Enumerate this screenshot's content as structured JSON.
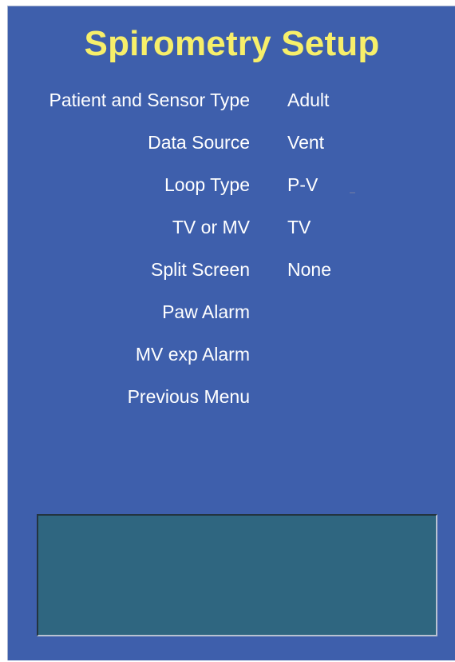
{
  "title": "Spirometry Setup",
  "menu": [
    {
      "label": "Patient and Sensor Type",
      "value": "Adult"
    },
    {
      "label": "Data Source",
      "value": "Vent"
    },
    {
      "label": "Loop Type",
      "value": "P-V"
    },
    {
      "label": "TV or MV",
      "value": "TV"
    },
    {
      "label": "Split Screen",
      "value": "None"
    },
    {
      "label": "Paw Alarm",
      "value": ""
    },
    {
      "label": "MV exp Alarm",
      "value": ""
    },
    {
      "label": "Previous Menu",
      "value": ""
    }
  ],
  "message_box": {
    "text": ""
  },
  "colors": {
    "background": "#3e5fac",
    "title": "#f7ef6a",
    "text": "#ffffff",
    "message_box": "#2f6680"
  }
}
